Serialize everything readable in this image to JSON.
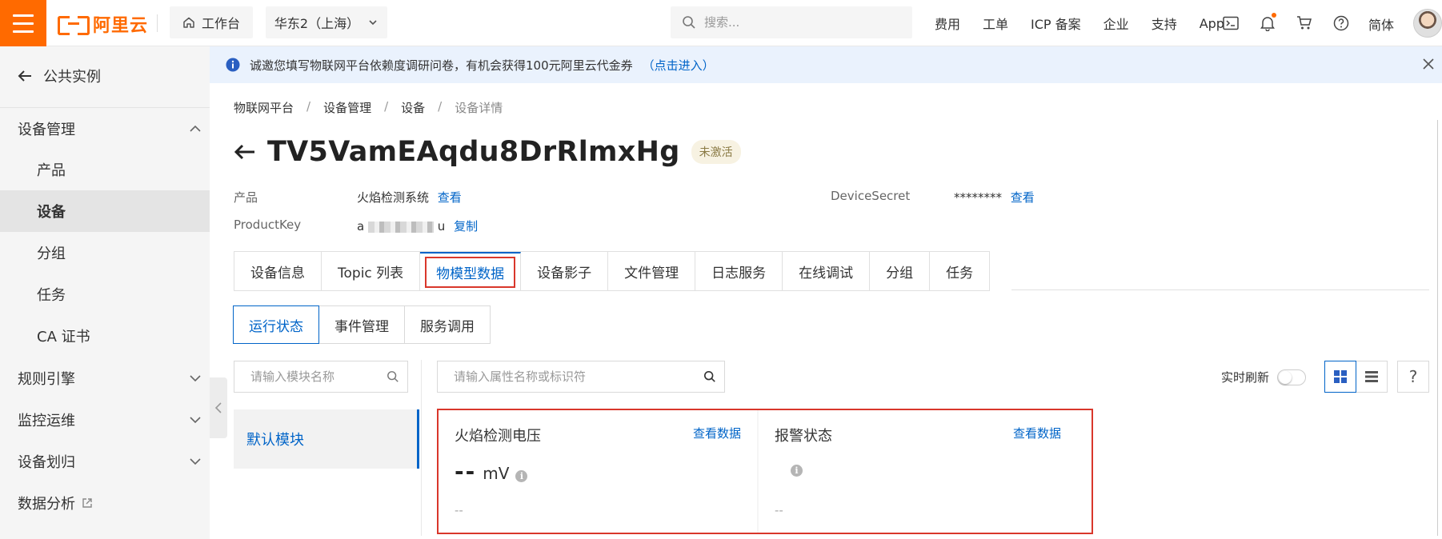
{
  "topbar": {
    "logo_text": "阿里云",
    "workbench_label": "工作台",
    "region_label": "华东2（上海）",
    "search_placeholder": "搜索...",
    "nav_links": [
      "费用",
      "工单",
      "ICP 备案",
      "企业",
      "支持",
      "App"
    ],
    "language": "简体",
    "accent_color": "#ff6a00"
  },
  "sidebar": {
    "back_label": "公共实例",
    "groups": {
      "device_mgmt": "设备管理",
      "rules": "规则引擎",
      "monitor": "监控运维",
      "device_assign": "设备划归",
      "data_analysis": "数据分析"
    },
    "items": [
      "产品",
      "设备",
      "分组",
      "任务",
      "CA 证书"
    ],
    "active_item": "设备"
  },
  "notice": {
    "text": "诚邀您填写物联网平台依赖度调研问卷，有机会获得100元阿里云代金券",
    "link": "（点击进入）"
  },
  "breadcrumb": [
    "物联网平台",
    "设备管理",
    "设备",
    "设备详情"
  ],
  "breadcrumb_sep": "/",
  "device": {
    "name": "TV5VamEAqdu8DrRlmxHg",
    "status": "未激活",
    "product_label": "产品",
    "product_value": "火焰检测系统",
    "product_link": "查看",
    "productkey_label": "ProductKey",
    "productkey_prefix": "a",
    "productkey_suffix": "u",
    "productkey_link": "复制",
    "secret_label": "DeviceSecret",
    "secret_value": "********",
    "secret_link": "查看"
  },
  "tabs": [
    "设备信息",
    "Topic 列表",
    "物模型数据",
    "设备影子",
    "文件管理",
    "日志服务",
    "在线调试",
    "分组",
    "任务"
  ],
  "active_tab": "物模型数据",
  "subtabs": [
    "运行状态",
    "事件管理",
    "服务调用"
  ],
  "active_subtab": "运行状态",
  "module_search_placeholder": "请输入模块名称",
  "property_search_placeholder": "请输入属性名称或标识符",
  "module_item": "默认模块",
  "realtime_label": "实时刷新",
  "realtime_on": false,
  "help_label": "?",
  "cards": [
    {
      "title": "火焰检测电压",
      "link": "查看数据",
      "value": "--",
      "unit": "mV",
      "timestamp": "--"
    },
    {
      "title": "报警状态",
      "link": "查看数据",
      "value": "",
      "unit": "",
      "timestamp": "--"
    }
  ]
}
